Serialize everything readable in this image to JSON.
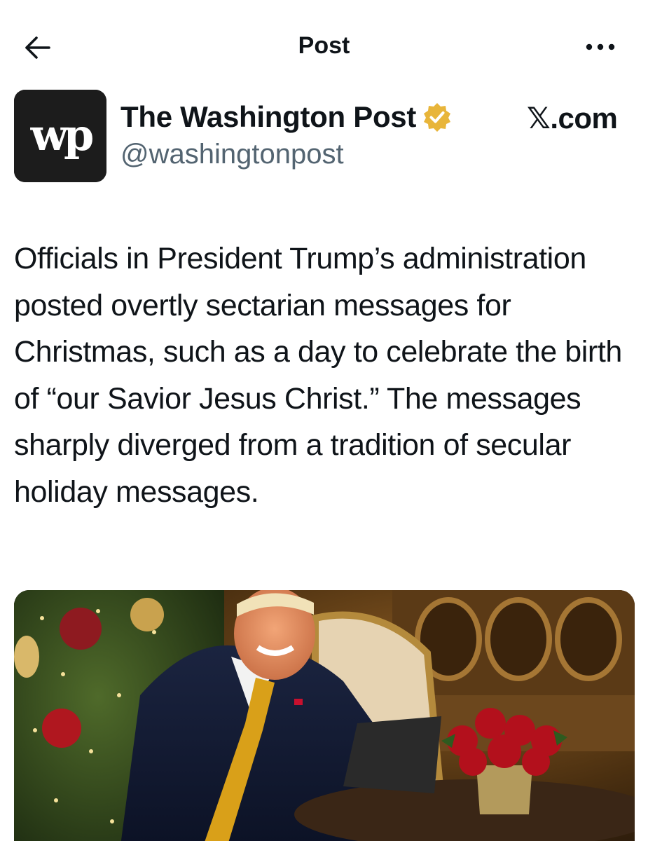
{
  "header": {
    "title": "Post",
    "back_icon": "arrow-left-icon",
    "more_icon": "more-horizontal-icon"
  },
  "author": {
    "name": "The Washington Post",
    "handle": "@washingtonpost",
    "avatar_text": "wp",
    "verified_color": "#e8b53a",
    "source": "𝕏.com"
  },
  "post": {
    "text": "Officials in President Trump’s administration posted overtly sectarian messages for Christmas, such as a day to celebrate the birth of “our Savior Jesus Christ.” The messages sharply diverged from a tradition of secular holiday messages."
  },
  "colors": {
    "text": "#0f1419",
    "secondary": "#536471",
    "background": "#ffffff"
  }
}
